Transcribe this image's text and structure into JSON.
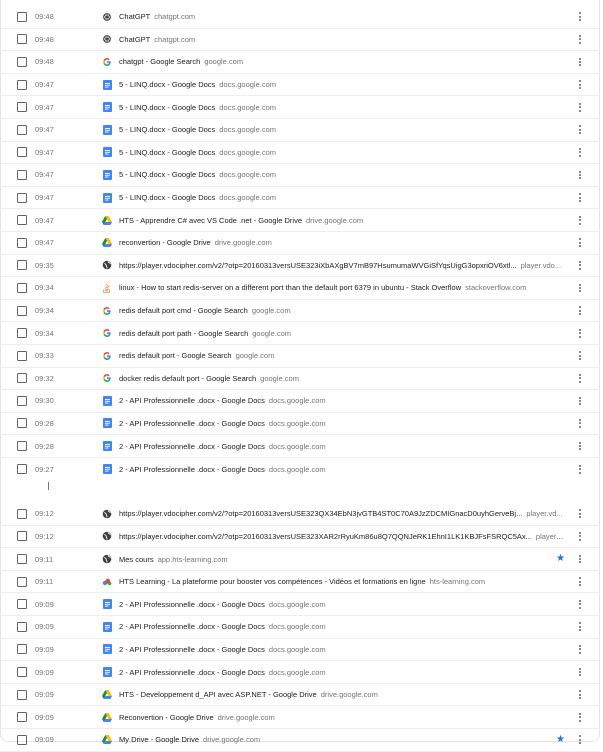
{
  "history": {
    "rows": [
      {
        "time": "09:48",
        "title": "ChatGPT",
        "domain": "chatgpt.com",
        "icon": "chatgpt-icon",
        "starred": false
      },
      {
        "time": "09:48",
        "title": "ChatGPT",
        "domain": "chatgpt.com",
        "icon": "chatgpt-icon",
        "starred": false
      },
      {
        "time": "09:48",
        "title": "chatgpt - Google Search",
        "domain": "google.com",
        "icon": "google-icon",
        "starred": false
      },
      {
        "time": "09:47",
        "title": "5 - LINQ.docx - Google Docs",
        "domain": "docs.google.com",
        "icon": "google-docs-icon",
        "starred": false
      },
      {
        "time": "09:47",
        "title": "5 - LINQ.docx - Google Docs",
        "domain": "docs.google.com",
        "icon": "google-docs-icon",
        "starred": false
      },
      {
        "time": "09:47",
        "title": "5 - LINQ.docx - Google Docs",
        "domain": "docs.google.com",
        "icon": "google-docs-icon",
        "starred": false
      },
      {
        "time": "09:47",
        "title": "5 - LINQ.docx - Google Docs",
        "domain": "docs.google.com",
        "icon": "google-docs-icon",
        "starred": false
      },
      {
        "time": "09:47",
        "title": "5 - LINQ.docx - Google Docs",
        "domain": "docs.google.com",
        "icon": "google-docs-icon",
        "starred": false
      },
      {
        "time": "09:47",
        "title": "5 - LINQ.docx - Google Docs",
        "domain": "docs.google.com",
        "icon": "google-docs-icon",
        "starred": false
      },
      {
        "time": "09:47",
        "title": "HTS - Apprendre C# avec VS Code .net - Google Drive",
        "domain": "drive.google.com",
        "icon": "google-drive-icon",
        "starred": false
      },
      {
        "time": "09:47",
        "title": "reconvertion - Google Drive",
        "domain": "drive.google.com",
        "icon": "google-drive-icon",
        "starred": false
      },
      {
        "time": "09:35",
        "title": "https://player.vdocipher.com/v2/?otp=20160313versUSE323iXbAXgBV7mB97HsumumaWVGiSfYqsUigG3opxriOV6xtl...",
        "domain": "player.vdo...",
        "icon": "globe-icon",
        "starred": false
      },
      {
        "time": "09:34",
        "title": "linux - How to start redis-server on a different port than the default port 6379 in ubuntu - Stack Overflow",
        "domain": "stackoverflow.com",
        "icon": "stackoverflow-icon",
        "starred": false
      },
      {
        "time": "09:34",
        "title": "redis default port cmd - Google Search",
        "domain": "google.com",
        "icon": "google-icon",
        "starred": false
      },
      {
        "time": "09:34",
        "title": "redis default port path - Google Search",
        "domain": "google.com",
        "icon": "google-icon",
        "starred": false
      },
      {
        "time": "09:33",
        "title": "redis default port - Google Search",
        "domain": "google.com",
        "icon": "google-icon",
        "starred": false
      },
      {
        "time": "09:32",
        "title": "docker redis default port - Google Search",
        "domain": "google.com",
        "icon": "google-icon",
        "starred": false
      },
      {
        "time": "09:30",
        "title": "2 - API Professionnelle .docx - Google Docs",
        "domain": "docs.google.com",
        "icon": "google-docs-icon",
        "starred": false
      },
      {
        "time": "09:28",
        "title": "2 - API Professionnelle .docx - Google Docs",
        "domain": "docs.google.com",
        "icon": "google-docs-icon",
        "starred": false
      },
      {
        "time": "09:28",
        "title": "2 - API Professionnelle .docx - Google Docs",
        "domain": "docs.google.com",
        "icon": "google-docs-icon",
        "starred": false
      },
      {
        "time": "09:27",
        "title": "2 - API Professionnelle .docx - Google Docs",
        "domain": "docs.google.com",
        "icon": "google-docs-icon",
        "starred": false
      },
      {
        "gap": true
      },
      {
        "time": "09:12",
        "title": "https://player.vdocipher.com/v2/?otp=20160313versUSE323QX34EbN3jvGTB4ST0C70A9JzZDCMIGnacD0uyhGerveBj...",
        "domain": "player.vd...",
        "icon": "globe-icon",
        "starred": false
      },
      {
        "time": "09:12",
        "title": "https://player.vdocipher.com/v2/?otp=20160313versUSE323XAR2rRyuKm86u8Q7QQNJeRK1EhnI1LK1KBJFsFSRQC5Ax...",
        "domain": "player.vdo...",
        "icon": "globe-icon",
        "starred": false
      },
      {
        "time": "09:11",
        "title": "Mes cours",
        "domain": "app.hts-learning.com",
        "icon": "globe-icon",
        "starred": true
      },
      {
        "time": "09:11",
        "title": "HTS Learning - La plateforme pour booster vos compétences - Vidéos et formations en ligne",
        "domain": "hts-learning.com",
        "icon": "hts-learning-icon",
        "starred": false
      },
      {
        "time": "09:09",
        "title": "2 - API Professionnelle .docx - Google Docs",
        "domain": "docs.google.com",
        "icon": "google-docs-icon",
        "starred": false
      },
      {
        "time": "09:09",
        "title": "2 - API Professionnelle .docx - Google Docs",
        "domain": "docs.google.com",
        "icon": "google-docs-icon",
        "starred": false
      },
      {
        "time": "09:09",
        "title": "2 - API Professionnelle .docx - Google Docs",
        "domain": "docs.google.com",
        "icon": "google-docs-icon",
        "starred": false
      },
      {
        "time": "09:09",
        "title": "2 - API Professionnelle .docx - Google Docs",
        "domain": "docs.google.com",
        "icon": "google-docs-icon",
        "starred": false
      },
      {
        "time": "09:09",
        "title": "HTS - Developpement d_API avec ASP.NET - Google Drive",
        "domain": "drive.google.com",
        "icon": "google-drive-icon",
        "starred": false
      },
      {
        "time": "09:09",
        "title": "Reconvertion - Google Drive",
        "domain": "drive.google.com",
        "icon": "google-drive-icon",
        "starred": false
      },
      {
        "time": "09:09",
        "title": "My Drive - Google Drive",
        "domain": "drive.google.com",
        "icon": "google-drive-icon",
        "starred": true
      }
    ]
  },
  "icons": {
    "more": "more-vert-icon",
    "star": "star-icon"
  },
  "colors": {
    "star": "#1a73e8",
    "docs": "#4285f4",
    "time": "#70757a",
    "domain": "#70757a"
  }
}
